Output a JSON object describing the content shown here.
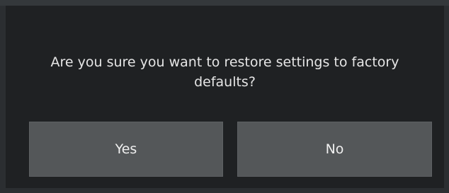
{
  "dialog": {
    "message": "Are you sure you want to restore settings to factory defaults?",
    "yes_label": "Yes",
    "no_label": "No"
  },
  "colors": {
    "background": "#1f2123",
    "button": "#545759",
    "text": "#e6e6e6"
  }
}
